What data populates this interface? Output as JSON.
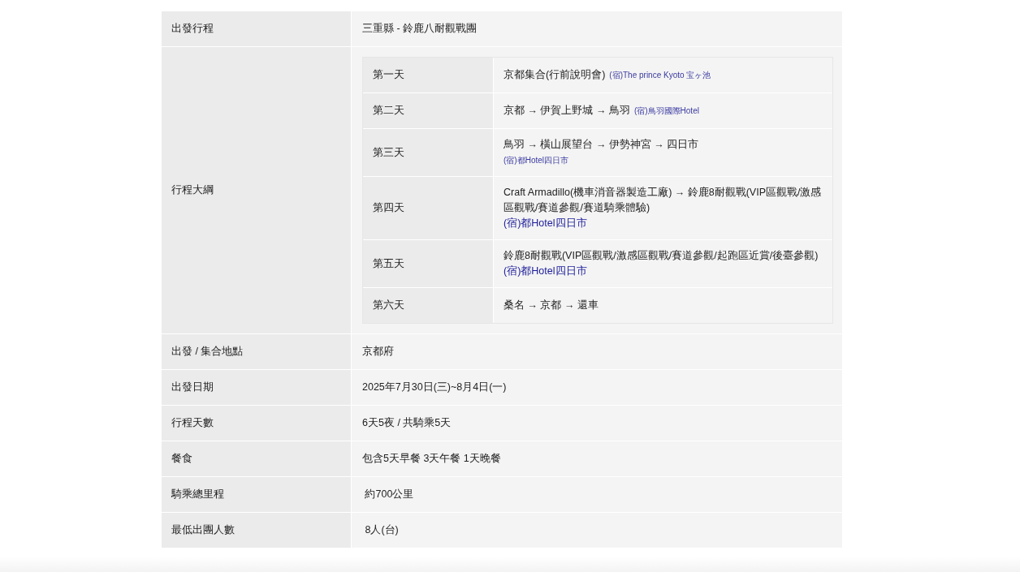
{
  "rows": [
    {
      "label": "出發行程",
      "value": "三重縣 - 鈴鹿八耐觀戰團"
    },
    {
      "label": "行程大綱",
      "days": [
        {
          "day": "第一天",
          "route": "京都集合(行前說明會)",
          "hotel": {
            "text": "(宿)The prince Kyoto 宝ヶ池",
            "kind": "inline"
          }
        },
        {
          "day": "第二天",
          "route": "京都 → 伊賀上野城 → 鳥羽",
          "hotel": {
            "text": "(宿)鳥羽國際Hotel",
            "kind": "inline"
          }
        },
        {
          "day": "第三天",
          "route": "鳥羽 → 橫山展望台 → 伊勢神宮 → 四日市",
          "hotel": {
            "text": "(宿)都Hotel四日市",
            "kind": "small-line"
          }
        },
        {
          "day": "第四天",
          "route": "Craft Armadillo(機車消音器製造工廠) → 鈴鹿8耐觀戰(VIP區觀戰/激感區觀戰/賽道參觀/賽道騎乘體驗)",
          "hotel": {
            "text": "(宿)都Hotel四日市",
            "kind": "line"
          }
        },
        {
          "day": "第五天",
          "route": "鈴鹿8耐觀戰(VIP區觀戰/激感區觀戰/賽道參觀/起跑區近賞/後臺參觀)",
          "hotel": {
            "text": "(宿)都Hotel四日市",
            "kind": "line"
          }
        },
        {
          "day": "第六天",
          "route": "桑名 → 京都 → 還車"
        }
      ]
    },
    {
      "label": "出發 / 集合地點",
      "value": "京都府"
    },
    {
      "label": "出發日期",
      "value": "2025年7月30日(三)~8月4日(一)"
    },
    {
      "label": "行程天數",
      "value": "6天5夜 / 共騎乘5天"
    },
    {
      "label": "餐食",
      "value": "包含5天早餐 3天午餐 1天晚餐"
    },
    {
      "label": "騎乘總里程",
      "value": " 約700公里"
    },
    {
      "label": "最低出團人數",
      "value": " 8人(台)"
    }
  ]
}
